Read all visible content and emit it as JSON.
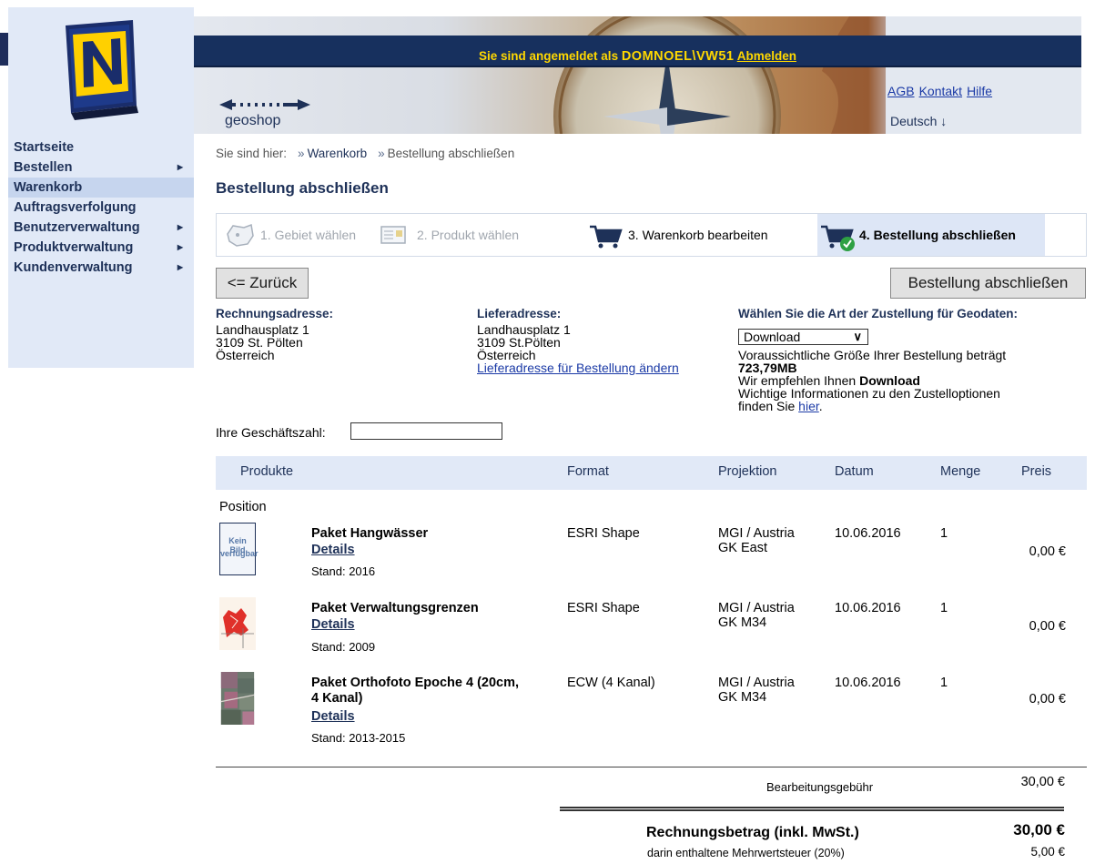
{
  "header": {
    "login_prefix": "Sie sind angemeldet als ",
    "user": "DOMNOEL\\VW51",
    "logout": "Abmelden",
    "links": [
      "AGB",
      "Kontakt",
      "Hilfe"
    ],
    "language": "Deutsch ↓",
    "geoshop_label": "geoshop"
  },
  "sidebar": {
    "items": [
      {
        "label": "Startseite",
        "has_submenu": false
      },
      {
        "label": "Bestellen",
        "has_submenu": true
      },
      {
        "label": "Warenkorb",
        "has_submenu": false,
        "active": true
      },
      {
        "label": "Auftragsverfolgung",
        "has_submenu": false
      },
      {
        "label": "Benutzerverwaltung",
        "has_submenu": true
      },
      {
        "label": "Produktverwaltung",
        "has_submenu": true
      },
      {
        "label": "Kundenverwaltung",
        "has_submenu": true
      }
    ]
  },
  "breadcrumb": {
    "prefix": "Sie sind hier:",
    "items": [
      "Warenkorb",
      "Bestellung abschließen"
    ]
  },
  "page_title": "Bestellung abschließen",
  "steps": [
    {
      "label": "1. Gebiet wählen",
      "state": "done"
    },
    {
      "label": "2. Produkt wählen",
      "state": "done"
    },
    {
      "label": "3. Warenkorb bearbeiten",
      "state": "enabled"
    },
    {
      "label": "4. Bestellung abschließen",
      "state": "current"
    }
  ],
  "buttons": {
    "back": "<= Zurück",
    "finish": "Bestellung abschließen"
  },
  "billing": {
    "heading": "Rechnungsadresse:",
    "lines": [
      "Landhausplatz 1",
      "3109 St. Pölten",
      "Österreich"
    ]
  },
  "delivery": {
    "heading": "Lieferadresse:",
    "lines": [
      "Landhausplatz 1",
      "3109 St.Pölten",
      "Österreich"
    ],
    "change_link": "Lieferadresse für Bestellung ändern"
  },
  "shipping": {
    "heading": "Wählen Sie die Art der Zustellung für Geodaten:",
    "selected": "Download",
    "size_text": "Voraussichtliche Größe Ihrer Bestellung beträgt",
    "size_value": "723,79MB",
    "recommend_prefix": "Wir empfehlen Ihnen ",
    "recommend_value": "Download",
    "info_line1": "Wichtige Informationen zu den Zustelloptionen",
    "info_prefix": "finden Sie ",
    "info_link": "hier",
    "info_suffix": "."
  },
  "business_number": {
    "label": "Ihre Geschäftszahl:",
    "value": ""
  },
  "table": {
    "headers": {
      "products": "Produkte",
      "format": "Format",
      "projection": "Projektion",
      "date": "Datum",
      "qty": "Menge",
      "price": "Preis"
    },
    "position_label": "Position",
    "details_label": "Details",
    "rows": [
      {
        "name": "Paket Hangwässer",
        "stand": "Stand: 2016",
        "format": "ESRI Shape",
        "proj1": "MGI / Austria",
        "proj2": "GK East",
        "date": "10.06.2016",
        "qty": "1",
        "price": "0,00 €",
        "thumb_text1": "Kein Bild",
        "thumb_text2": "verfügbar"
      },
      {
        "name": "Paket Verwaltungsgrenzen",
        "stand": "Stand: 2009",
        "format": "ESRI Shape",
        "proj1": "MGI / Austria",
        "proj2": "GK M34",
        "date": "10.06.2016",
        "qty": "1",
        "price": "0,00 €"
      },
      {
        "name": "Paket Orthofoto Epoche 4 (20cm, 4 Kanal)",
        "stand": "Stand: 2013-2015",
        "format": "ECW (4 Kanal)",
        "proj1": "MGI / Austria",
        "proj2": "GK M34",
        "date": "10.06.2016",
        "qty": "1",
        "price": "0,00 €"
      }
    ]
  },
  "totals": {
    "fee_label": "Bearbeitungsgebühr",
    "fee_value": "30,00 €",
    "total_label": "Rechnungsbetrag (inkl. MwSt.)",
    "total_value": "30,00 €",
    "vat_label": "darin enthaltene Mehrwertsteuer (20%)",
    "vat_value": "5,00 €"
  },
  "colors": {
    "navy": "#17305e",
    "accent_yellow": "#ffd800",
    "sidebar_bg": "#e1e9f7",
    "link": "#1b3aa6"
  }
}
